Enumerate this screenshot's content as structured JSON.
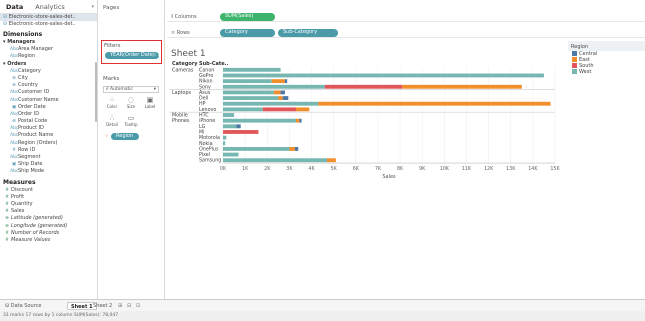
{
  "left_panel": {
    "tab_data": "Data",
    "tab_analytics": "Analytics",
    "data_sources": [
      "Electronic-store-sales-det..",
      "Electronic-store-sales-det.."
    ],
    "dimensions_title": "Dimensions",
    "dimensions": [
      {
        "kind": "group",
        "label": "Managers"
      },
      {
        "kind": "field",
        "icon": "Abc",
        "label": "Area Manager",
        "indent": true
      },
      {
        "kind": "field",
        "icon": "Abc",
        "label": "Region",
        "indent": true
      },
      {
        "kind": "group",
        "label": "Orders"
      },
      {
        "kind": "field",
        "icon": "Abc",
        "label": "Category",
        "indent": true
      },
      {
        "kind": "field",
        "icon": "geo",
        "label": "City",
        "indent": true
      },
      {
        "kind": "field",
        "icon": "geo",
        "label": "Country",
        "indent": true
      },
      {
        "kind": "field",
        "icon": "Abc",
        "label": "Customer ID",
        "indent": true
      },
      {
        "kind": "field",
        "icon": "Abc",
        "label": "Customer Name",
        "indent": true
      },
      {
        "kind": "field",
        "icon": "date",
        "label": "Order Date",
        "indent": true
      },
      {
        "kind": "field",
        "icon": "Abc",
        "label": "Order ID",
        "indent": true
      },
      {
        "kind": "field",
        "icon": "geo",
        "label": "Postal Code",
        "indent": true
      },
      {
        "kind": "field",
        "icon": "Abc",
        "label": "Product ID",
        "indent": true
      },
      {
        "kind": "field",
        "icon": "Abc",
        "label": "Product Name",
        "indent": true
      },
      {
        "kind": "field",
        "icon": "Abc",
        "label": "Region (Orders)",
        "indent": true
      },
      {
        "kind": "field",
        "icon": "#",
        "label": "Row ID",
        "indent": true
      },
      {
        "kind": "field",
        "icon": "Abc",
        "label": "Segment",
        "indent": true
      },
      {
        "kind": "field",
        "icon": "date",
        "label": "Ship Date",
        "indent": true
      },
      {
        "kind": "field",
        "icon": "Abc",
        "label": "Ship Mode",
        "indent": true
      }
    ],
    "measures_title": "Measures",
    "measures": [
      {
        "icon": "#",
        "label": "Discount"
      },
      {
        "icon": "#",
        "label": "Profit"
      },
      {
        "icon": "#",
        "label": "Quantity"
      },
      {
        "icon": "#",
        "label": "Sales"
      },
      {
        "icon": "geo",
        "label": "Latitude (generated)"
      },
      {
        "icon": "geo",
        "label": "Longitude (generated)"
      },
      {
        "icon": "#",
        "label": "Number of Records"
      },
      {
        "icon": "#",
        "label": "Measure Values"
      }
    ]
  },
  "pages_card": {
    "title": "Pages"
  },
  "filters_card": {
    "title": "Filters",
    "pill": "YEAR(Order Date): 2..."
  },
  "marks_card": {
    "title": "Marks",
    "type": "Automatic",
    "buttons": [
      "Color",
      "Size",
      "Label",
      "Detail",
      "Tooltip"
    ],
    "color_pill": "Region"
  },
  "shelves": {
    "columns_label": "Columns",
    "columns_pills": [
      "SUM(Sales)"
    ],
    "rows_label": "Rows",
    "rows_pills": [
      "Category",
      "Sub-Category"
    ]
  },
  "sheet_title": "Sheet 1",
  "header": {
    "category": "Category",
    "subcategory": "Sub-Cate.."
  },
  "legend": {
    "title": "Region",
    "items": [
      {
        "name": "Central",
        "color": "#4e79a7"
      },
      {
        "name": "East",
        "color": "#f28e2b"
      },
      {
        "name": "South",
        "color": "#e15759"
      },
      {
        "name": "West",
        "color": "#76b7b2"
      }
    ]
  },
  "chart_data": {
    "type": "bar",
    "orientation": "horizontal-stacked",
    "xlabel": "Sales",
    "xlim": [
      0,
      15000
    ],
    "x_ticks": [
      "0K",
      "1K",
      "2K",
      "3K",
      "4K",
      "5K",
      "6K",
      "7K",
      "8K",
      "9K",
      "10K",
      "11K",
      "12K",
      "13K",
      "14K",
      "15K"
    ],
    "groups": [
      {
        "category": "Cameras",
        "subcategories": [
          "Canon",
          "GoPro",
          "Nikon",
          "Sony"
        ]
      },
      {
        "category": "Laptops",
        "subcategories": [
          "Asus",
          "Dell",
          "HP",
          "Lenovo"
        ]
      },
      {
        "category": "Mobile Phones",
        "subcategories": [
          "HTC",
          "iPhone",
          "LG",
          "Mi",
          "Motorola",
          "Nokia",
          "OnePlus",
          "Pixel",
          "Samsung"
        ]
      }
    ],
    "bars": [
      {
        "sub": "Canon",
        "segments": [
          {
            "region": "West",
            "value": 2600
          }
        ]
      },
      {
        "sub": "GoPro",
        "segments": [
          {
            "region": "West",
            "value": 14500
          }
        ]
      },
      {
        "sub": "Nikon",
        "segments": [
          {
            "region": "West",
            "value": 2200
          },
          {
            "region": "East",
            "value": 600
          },
          {
            "region": "Central",
            "value": 100
          }
        ]
      },
      {
        "sub": "Sony",
        "segments": [
          {
            "region": "West",
            "value": 4600
          },
          {
            "region": "South",
            "value": 3500
          },
          {
            "region": "East",
            "value": 5400
          }
        ]
      },
      {
        "sub": "Asus",
        "segments": [
          {
            "region": "West",
            "value": 2300
          },
          {
            "region": "East",
            "value": 300
          },
          {
            "region": "Central",
            "value": 200
          }
        ]
      },
      {
        "sub": "Dell",
        "segments": [
          {
            "region": "West",
            "value": 2500
          },
          {
            "region": "East",
            "value": 200
          },
          {
            "region": "Central",
            "value": 250
          }
        ]
      },
      {
        "sub": "HP",
        "segments": [
          {
            "region": "West",
            "value": 4300
          },
          {
            "region": "East",
            "value": 10500
          }
        ]
      },
      {
        "sub": "Lenovo",
        "segments": [
          {
            "region": "West",
            "value": 1800
          },
          {
            "region": "South",
            "value": 1500
          },
          {
            "region": "East",
            "value": 600
          }
        ]
      },
      {
        "sub": "HTC",
        "segments": [
          {
            "region": "West",
            "value": 500
          }
        ]
      },
      {
        "sub": "iPhone",
        "segments": [
          {
            "region": "West",
            "value": 3300
          },
          {
            "region": "East",
            "value": 150
          },
          {
            "region": "Central",
            "value": 100
          }
        ]
      },
      {
        "sub": "LG",
        "segments": [
          {
            "region": "West",
            "value": 600
          },
          {
            "region": "Central",
            "value": 200
          }
        ]
      },
      {
        "sub": "Mi",
        "segments": [
          {
            "region": "South",
            "value": 1600
          }
        ]
      },
      {
        "sub": "Motorola",
        "segments": [
          {
            "region": "West",
            "value": 150
          }
        ]
      },
      {
        "sub": "Nokia",
        "segments": [
          {
            "region": "West",
            "value": 100
          }
        ]
      },
      {
        "sub": "OnePlus",
        "segments": [
          {
            "region": "West",
            "value": 3000
          },
          {
            "region": "East",
            "value": 250
          },
          {
            "region": "Central",
            "value": 150
          }
        ]
      },
      {
        "sub": "Pixel",
        "segments": [
          {
            "region": "West",
            "value": 700
          }
        ]
      },
      {
        "sub": "Samsung",
        "segments": [
          {
            "region": "West",
            "value": 4700
          },
          {
            "region": "East",
            "value": 400
          }
        ]
      }
    ]
  },
  "bottom": {
    "tabs": [
      "Data Source",
      "Sheet 1",
      "Sheet 2"
    ],
    "status": "31 marks   17 rows by 1 column   SUM(Sales): 78,047"
  }
}
